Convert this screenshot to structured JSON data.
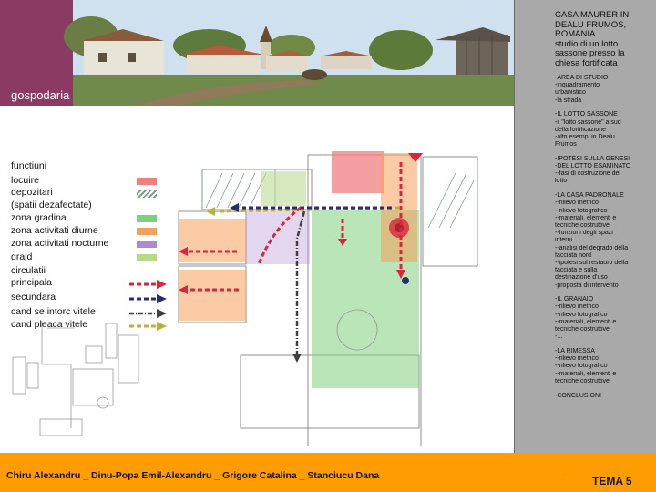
{
  "header": {
    "band_label": "gospodaria"
  },
  "panel": {
    "title_lines": [
      "CASA MAURER IN",
      "DEALU FRUMOS,",
      "ROMANIA",
      "studio di un lotto",
      "sassone presso la",
      "chiesa fortificata"
    ],
    "sections": [
      [
        "-AREA DI STUDIO",
        "-inquadramento",
        "urbanistico",
        "-la strada"
      ],
      [
        "-IL LOTTO SASSONE",
        "-il \"lotto sassone\" a sud",
        "della fortificazione",
        "-altri esempi in Dealu",
        "Frumos"
      ],
      [
        "-IPOTESI SULLA GENESI",
        "-DEL LOTTO ESAMINATO",
        "--fasi di costruzione del",
        "lotto"
      ],
      [
        "-LA CASA PADRONALE",
        "--rilievo metrico",
        "--rilievo fotografico",
        "--materiali, elementi e",
        "tecniche costruttive",
        "--funzioni degli spazi",
        "interni",
        "--analisi del degrado della",
        "facciata nord",
        "--ipotesi sul restauro della",
        "facciata e sulla",
        "destinazione d'uso",
        "-proposta di intervento"
      ],
      [
        "-IL GRANAIO",
        "--rilievo metrico",
        "--rilievo fotografico",
        "--materiali, elementi e",
        "tecniche costruttive",
        "-..."
      ],
      [
        "-LA RIMESSA",
        "--rilievo metrico",
        "--rilievo fotografico",
        "--materiali, elementi e",
        "tecniche costruttive"
      ],
      [
        "-CONCLUSIONI"
      ]
    ]
  },
  "legend": {
    "functiuni": "functiuni",
    "locuire": "locuire",
    "depozitari": "depozitari",
    "spatii": "(spatii dezafectate)",
    "zona_gradina": "zona gradina",
    "zona_diurne": "zona activitati diurne",
    "zona_nocturne": "zona activitati nocturne",
    "grajd": "grajd",
    "circulatii": "circulatii",
    "principala": "principala",
    "secundara": "secundara",
    "intorc": "cand se intorc vitele",
    "pleaca": "cand pleaca vitele",
    "colors": {
      "locuire": "#f08080",
      "depozitari": "#7f9f8a",
      "gradina": "#7fcf7f",
      "diurne": "#f5a15a",
      "nocturne": "#b08ad0",
      "grajd": "#b7d98b",
      "principala": "#d7263d",
      "secundara": "#2b2d6e",
      "intorc": "#404040",
      "pleaca": "#b5b535"
    }
  },
  "footer": {
    "authors": "Chiru Alexandru _ Dinu-Popa Emil-Alexandru _ Grigore Catalina _ Stanciucu Dana",
    "dash": "-",
    "tema": "TEMA 5"
  }
}
